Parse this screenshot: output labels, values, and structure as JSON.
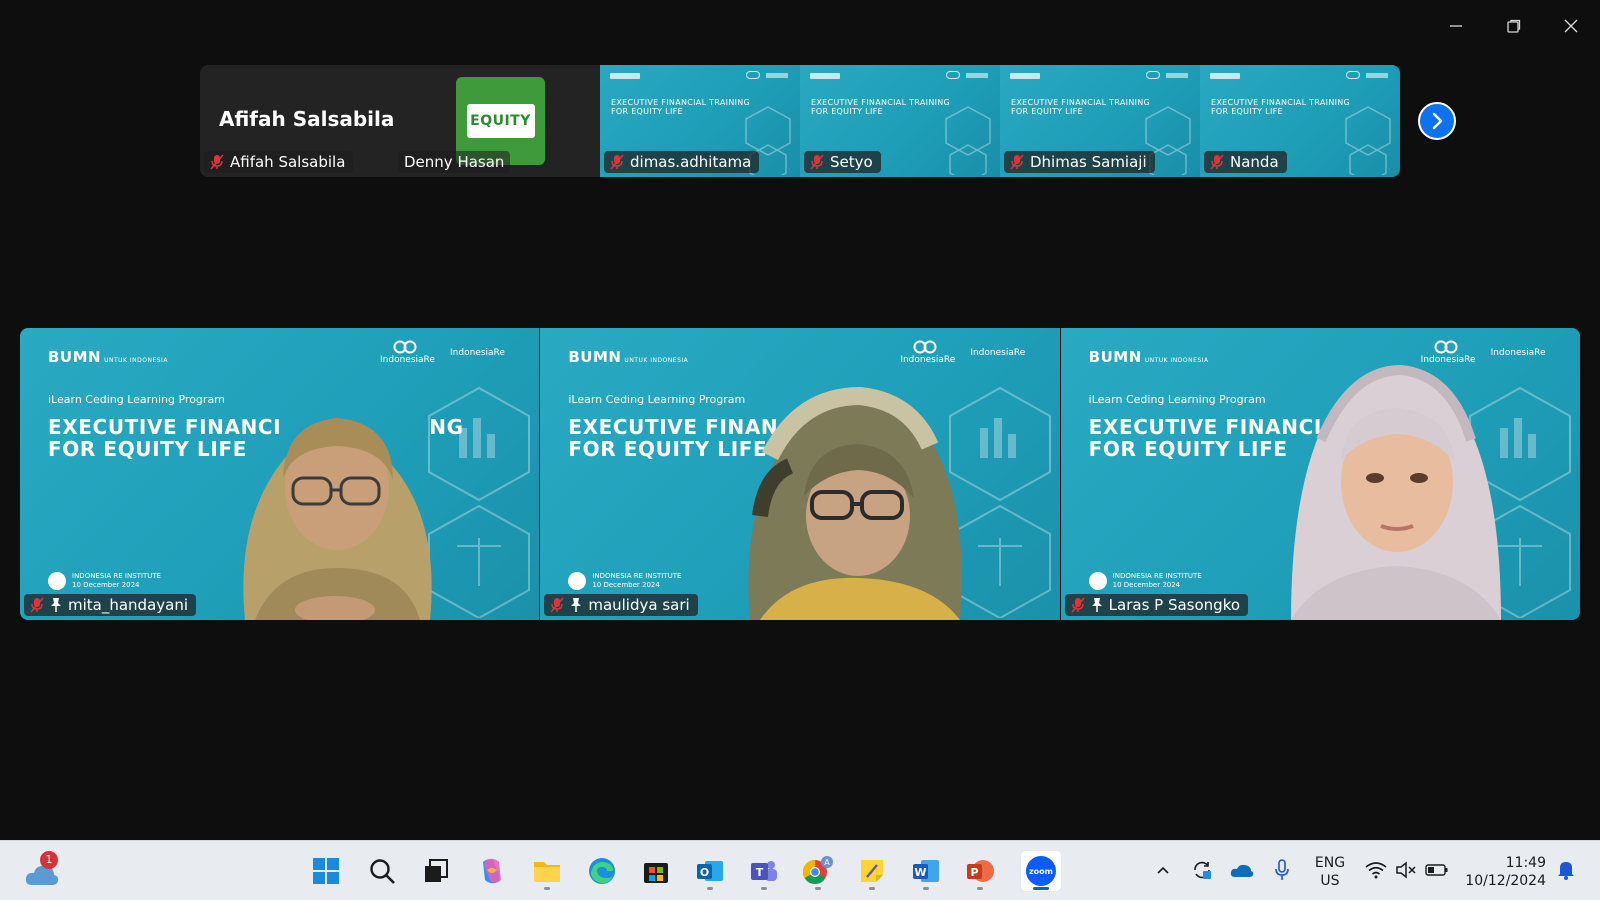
{
  "window": {
    "controls": {
      "minimize": "minimize",
      "restore": "restore",
      "close": "close"
    }
  },
  "strip": {
    "first": {
      "big_name": "Afifah Salsabila",
      "label": "Afifah Salsabila",
      "second_label": "Denny Hasan",
      "logo_text": "EQUITY"
    },
    "tiles": [
      {
        "label": "dimas.adhitama",
        "slide_title": "EXECUTIVE FINANCIAL TRAINING\nFOR EQUITY LIFE"
      },
      {
        "label": "Setyo",
        "slide_title": "EXECUTIVE FINANCIAL TRAINING\nFOR EQUITY LIFE"
      },
      {
        "label": "Dhimas Samiaji",
        "slide_title": "EXECUTIVE FINANCIAL TRAINING\nFOR EQUITY LIFE"
      },
      {
        "label": "Nanda",
        "slide_title": "EXECUTIVE FINANCIAL TRAINING\nFOR EQUITY LIFE"
      }
    ]
  },
  "slide": {
    "bumn": "BUMN",
    "bumn_sub": "UNTUK INDONESIA",
    "ire": "IndonesiaRe",
    "ire_inst": "IndonesiaRe",
    "program": "iLearn Ceding Learning Program",
    "footer_line1": "INDONESIA RE INSTITUTE",
    "footer_line2": "10 December 2024"
  },
  "gallery": [
    {
      "label": "mita_handayani",
      "title_line1": "EXECUTIVE FINANCI",
      "title_tail": "NG",
      "title_line2": "FOR EQUITY LIFE"
    },
    {
      "label": "maulidya sari",
      "title_line1": "EXECUTIVE FINAN",
      "title_tail": "",
      "title_line2": "FOR EQUITY LIFE"
    },
    {
      "label": "Laras P Sasongko",
      "title_line1": "EXECUTIVE FINANCIA",
      "title_tail": "",
      "title_line2": "FOR EQUITY LIFE"
    }
  ],
  "taskbar": {
    "weather_badge": "1",
    "apps": [
      "windows-start",
      "search",
      "task-view",
      "copilot",
      "file-explorer",
      "edge",
      "microsoft-store",
      "outlook",
      "teams",
      "chrome",
      "sticky-notes",
      "word",
      "powerpoint",
      "zoom"
    ],
    "lang_line1": "ENG",
    "lang_line2": "US",
    "time": "11:49",
    "date": "10/12/2024"
  },
  "colors": {
    "zoom_blue": "#0e72ed",
    "slide_teal": "#23a3bd",
    "mic_red": "#e0343a"
  }
}
